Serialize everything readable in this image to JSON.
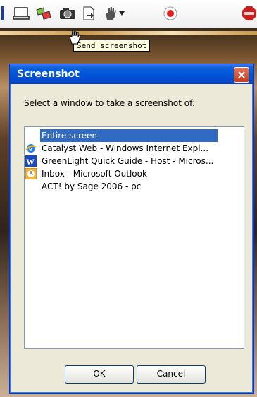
{
  "toolbar": {
    "tooltip": "Send screenshot",
    "buttons": [
      "desktop-icon",
      "share-icon",
      "camera-icon",
      "export-icon",
      "hand-icon",
      "dropdown-icon",
      "record-icon",
      "stop-icon"
    ]
  },
  "dialog": {
    "title": "Screenshot",
    "prompt": "Select a window to take a screenshot of:",
    "items": [
      {
        "label": "Entire screen",
        "icon": "none",
        "selected": true
      },
      {
        "label": "Catalyst Web - Windows Internet Expl...",
        "icon": "internet-explorer-icon"
      },
      {
        "label": "GreenLight Quick Guide - Host - Micros...",
        "icon": "word-icon"
      },
      {
        "label": "Inbox - Microsoft Outlook",
        "icon": "outlook-icon"
      },
      {
        "label": "ACT! by Sage 2006 - pc",
        "icon": "none"
      }
    ],
    "ok_label": "OK",
    "cancel_label": "Cancel"
  },
  "colors": {
    "title_bar": "#0052d6",
    "selection": "#316ac5",
    "dialog_bg": "#ece9d8"
  }
}
